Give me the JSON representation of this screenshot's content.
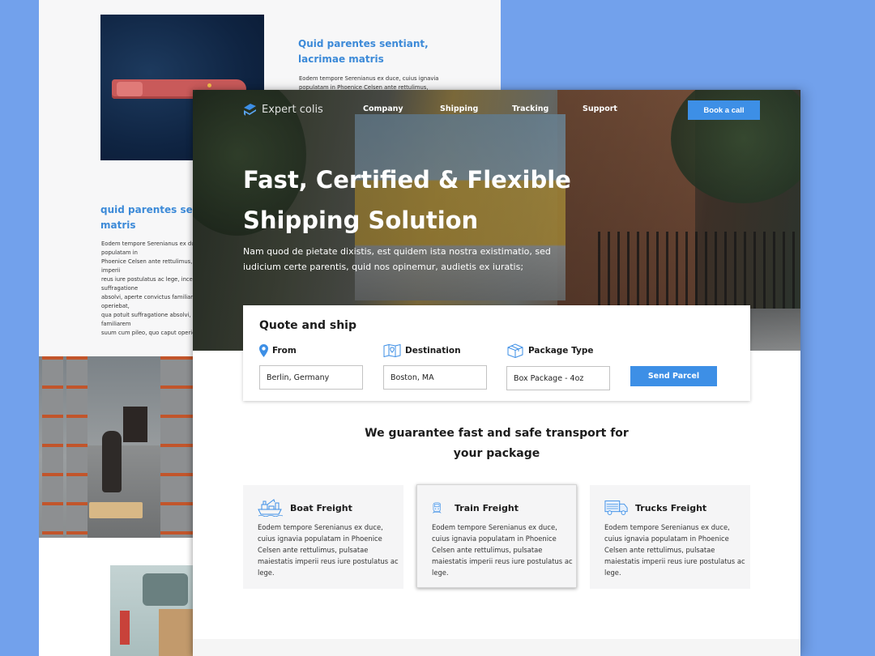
{
  "background_page": {
    "top_article": {
      "heading": "Quid parentes sentiant, lacrimae matris",
      "body": "Eodem tempore Serenianus ex duce, cuius ignavia populatam in Phoenice Celsen ante rettulimus,"
    },
    "mid_article": {
      "heading": "quid parentes sentiant, lacrimae matris",
      "body": "Eodem tempore Serenianus ex duce, cuius ignavia populatam in\nPhoenice Celsen ante rettulimus, pulsatae maiestatis imperii\nreus iure postulatus ac lege, incertum qua potuit suffragatione\nabsolvi, aperte convictus familiarem eius sui ac pilum\noperiebat,\nqua potuit suffragatione absolvi, aperte convictus familiarem\nsuum cum pileo, quo caput operiebat"
    },
    "images": [
      "aerial-cargo-ship",
      "warehouse-aisle",
      "delivery-van"
    ]
  },
  "nav": {
    "logo_text": "Expert colis",
    "links": [
      "Company",
      "Shipping",
      "Tracking",
      "Support"
    ],
    "cta": "Book a call"
  },
  "hero": {
    "title": "Fast, Certified & Flexible Shipping Solution",
    "subtitle": "Nam quod de pietate dixistis, est quidem ista nostra existimatio, sed iudicium certe parentis, quid nos opinemur, audietis ex iuratis;"
  },
  "quote": {
    "title": "Quote and ship",
    "fields": [
      {
        "label": "From",
        "icon": "map-pin-icon",
        "value": "Berlin, Germany"
      },
      {
        "label": "Destination",
        "icon": "map-icon",
        "value": "Boston, MA"
      },
      {
        "label": "Package Type",
        "icon": "package-box-icon",
        "value": "Box Package - 4oz"
      }
    ],
    "submit": "Send Parcel"
  },
  "guarantee": {
    "line1": "We guarantee fast and safe transport for",
    "line2": "your package"
  },
  "services": [
    {
      "title": "Boat Freight",
      "icon": "cargo-ship-icon",
      "description": "Eodem tempore Serenianus ex duce, cuius ignavia populatam in Phoenice Celsen ante rettulimus, pulsatae maiestatis imperii reus iure postulatus ac lege."
    },
    {
      "title": "Train Freight",
      "icon": "train-icon",
      "description": "Eodem tempore Serenianus ex duce, cuius ignavia populatam in Phoenice Celsen ante rettulimus, pulsatae maiestatis imperii reus iure postulatus ac lege."
    },
    {
      "title": "Trucks Freight",
      "icon": "truck-icon",
      "description": "Eodem tempore Serenianus ex duce, cuius ignavia populatam in Phoenice Celsen ante rettulimus, pulsatae maiestatis imperii reus iure postulatus ac lege."
    }
  ],
  "colors": {
    "accent": "#3d8fe6",
    "canvas_background": "#72a1ec",
    "heading_blue": "#3c8ad8",
    "card_background": "#f5f5f6"
  }
}
